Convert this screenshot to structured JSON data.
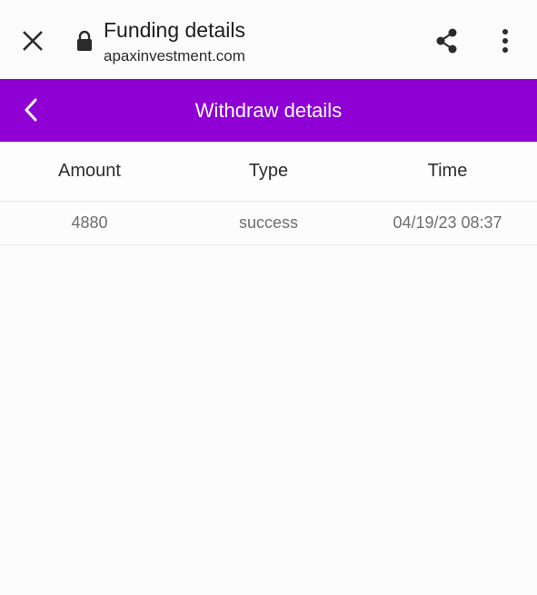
{
  "browser": {
    "title": "Funding details",
    "url": "apaxinvestment.com",
    "icons": {
      "close": "close-icon",
      "lock": "lock-icon",
      "share": "share-icon",
      "menu": "more-vert-icon"
    }
  },
  "header": {
    "title": "Withdraw details",
    "background": "#8e00d3",
    "back_icon": "chevron-left-icon"
  },
  "table": {
    "columns": [
      "Amount",
      "Type",
      "Time"
    ],
    "rows": [
      [
        "4880",
        "success",
        "04/19/23 08:37"
      ]
    ]
  }
}
